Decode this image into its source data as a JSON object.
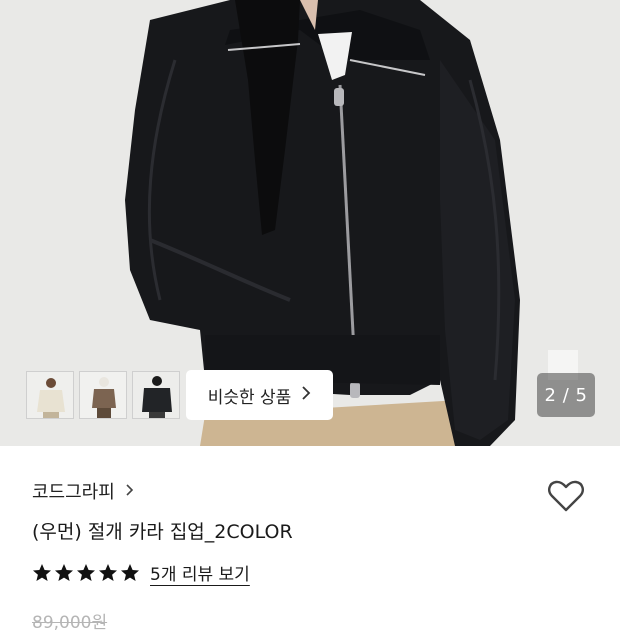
{
  "gallery": {
    "thumbnails": [
      "thumbnail-cream",
      "thumbnail-brown",
      "thumbnail-black"
    ],
    "similar_button_label": "비슷한 상품",
    "counter_text": "2 / 5"
  },
  "product": {
    "brand": "코드그라피",
    "name": "(우먼) 절개 카라 집업_2COLOR",
    "rating_stars": 5,
    "review_link": "5개 리뷰 보기",
    "original_price": "89,000원"
  },
  "icons": {
    "brand_chevron": "chevron-right-icon",
    "wishlist": "heart-outline-icon",
    "star": "star-icon"
  },
  "colors": {
    "star": "#111111",
    "heart_stroke": "#444444",
    "counter_bg": "rgba(70,70,70,0.55)"
  }
}
